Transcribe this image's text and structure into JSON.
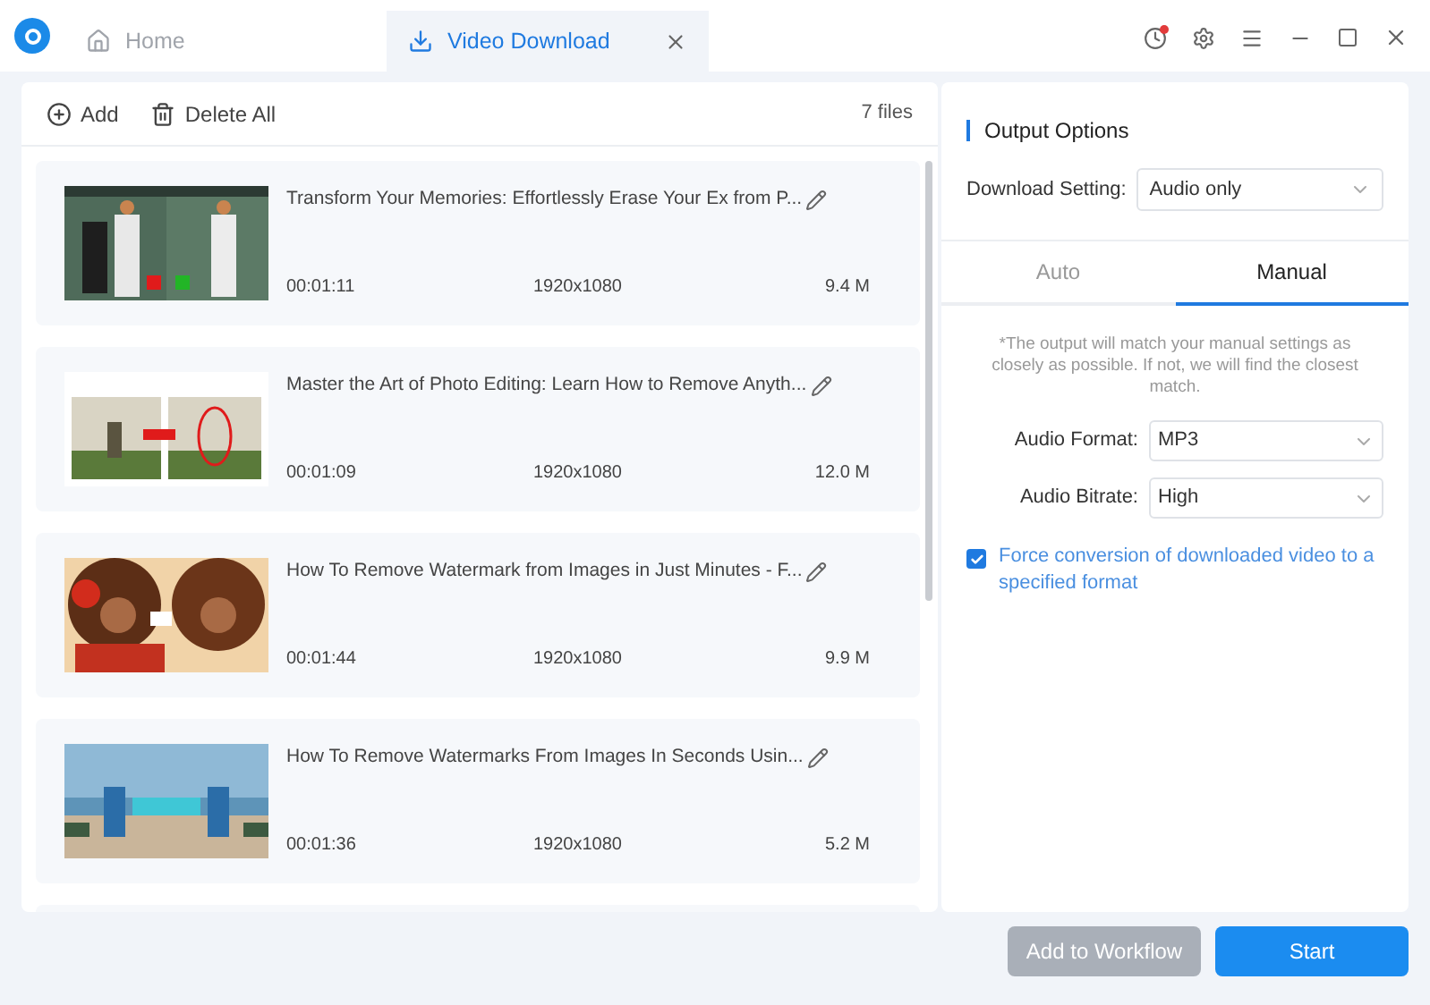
{
  "tabs": [
    {
      "label": "Home",
      "selected": false
    },
    {
      "label": "Video Download",
      "selected": true
    }
  ],
  "toolbar": {
    "add": "Add",
    "delete_all": "Delete All",
    "file_count": "7 files"
  },
  "videos": [
    {
      "title": "Transform Your Memories: Effortlessly Erase Your Ex from P...",
      "duration": "00:01:11",
      "resolution": "1920x1080",
      "size": "9.4 M"
    },
    {
      "title": "Master the Art of Photo Editing: Learn How to Remove Anyth...",
      "duration": "00:01:09",
      "resolution": "1920x1080",
      "size": "12.0 M"
    },
    {
      "title": "How To Remove Watermark from Images in Just Minutes - F...",
      "duration": "00:01:44",
      "resolution": "1920x1080",
      "size": "9.9 M"
    },
    {
      "title": "How To Remove Watermarks From Images In Seconds Usin...",
      "duration": "00:01:36",
      "resolution": "1920x1080",
      "size": "5.2 M"
    }
  ],
  "output": {
    "title": "Output Options",
    "download_setting_label": "Download Setting:",
    "download_setting": "Audio only",
    "modes": [
      {
        "label": "Auto",
        "selected": false
      },
      {
        "label": "Manual",
        "selected": true
      }
    ],
    "note": "*The output will match your manual settings as closely as possible. If not, we will find the closest match.",
    "fields": [
      {
        "label": "Audio Format:",
        "value": "MP3"
      },
      {
        "label": "Audio Bitrate:",
        "value": "High"
      }
    ],
    "force_conversion": {
      "label": "Force conversion of downloaded video to a specified format",
      "checked": true
    }
  },
  "buttons": [
    {
      "label": "Add to Workflow",
      "disabled": true
    },
    {
      "label": "Start",
      "disabled": false
    }
  ]
}
